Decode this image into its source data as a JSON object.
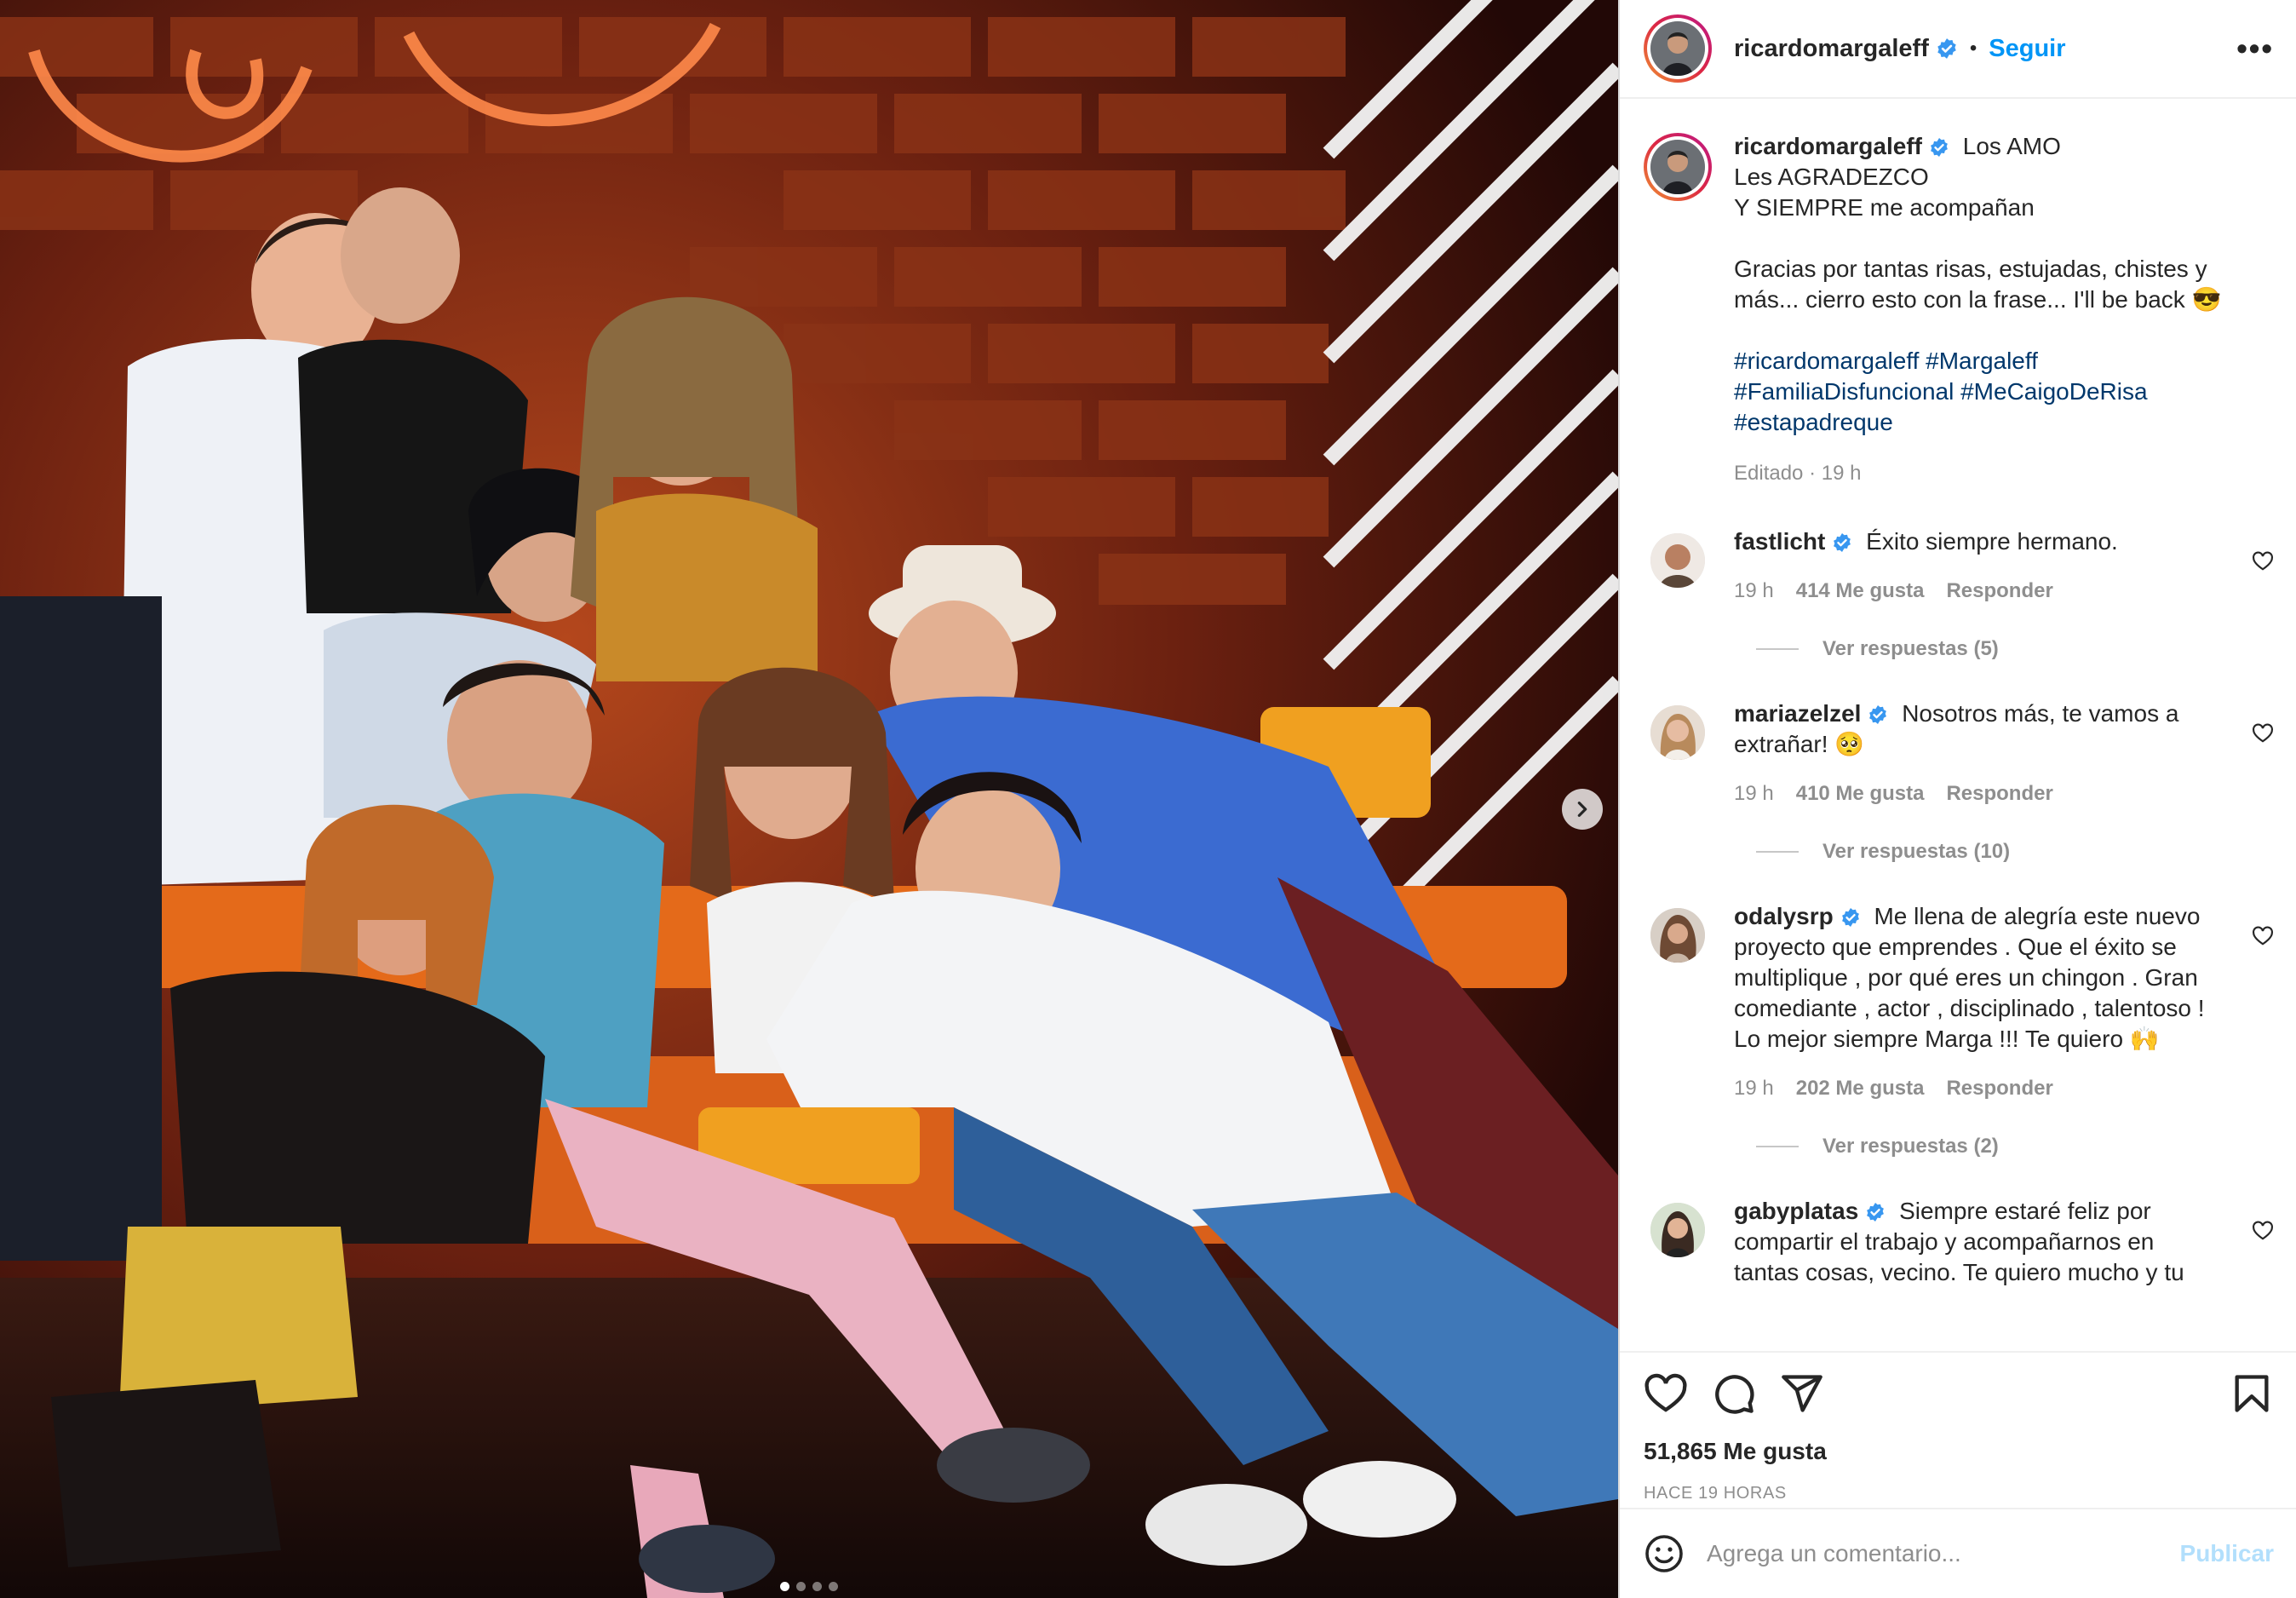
{
  "post": {
    "username": "ricardomargaleff",
    "follow_label": "Seguir",
    "separator": "•",
    "more_label": "•••"
  },
  "caption": {
    "username": "ricardomargaleff",
    "text": "Los AMO\nLes AGRADEZCO\nY SIEMPRE me acompañan\n\nGracias por tantas risas, estujadas, chistes y más... cierro esto con la frase... I'll be back 😎",
    "hashtags": "#ricardomargaleff #Margaleff\n#FamiliaDisfuncional #MeCaigoDeRisa\n#estapadreque",
    "meta": "Editado · 19 h"
  },
  "comments": [
    {
      "username": "fastlicht",
      "text": "Éxito siempre hermano.",
      "time": "19 h",
      "likes": "414 Me gusta",
      "reply": "Responder",
      "replies": "Ver respuestas (5)"
    },
    {
      "username": "mariazelzel",
      "text": "Nosotros más, te vamos a extrañar! 🥺",
      "time": "19 h",
      "likes": "410 Me gusta",
      "reply": "Responder",
      "replies": "Ver respuestas (10)"
    },
    {
      "username": "odalysrp",
      "text": "Me llena de alegría este nuevo proyecto que emprendes . Que el éxito se multiplique , por qué eres un chingon . Gran comediante , actor , disciplinado , talentoso ! Lo mejor siempre Marga !!! Te quiero 🙌",
      "time": "19 h",
      "likes": "202 Me gusta",
      "reply": "Responder",
      "replies": "Ver respuestas (2)"
    },
    {
      "username": "gabyplatas",
      "text": "Siempre estaré feliz por compartir el trabajo y acompañarnos en tantas cosas, vecino. Te quiero mucho y tu",
      "time": "",
      "likes": "",
      "reply": "",
      "replies": ""
    }
  ],
  "footer": {
    "likes": "51,865 Me gusta",
    "ago": "HACE 19 HORAS",
    "comment_placeholder": "Agrega un comentario...",
    "publish_label": "Publicar"
  },
  "colors": {
    "accent": "#0095f6",
    "link": "#00376b",
    "muted": "#8e8e8e",
    "verified": "#3897f0"
  },
  "media": {
    "carousel_count": 4,
    "carousel_index": 0
  }
}
